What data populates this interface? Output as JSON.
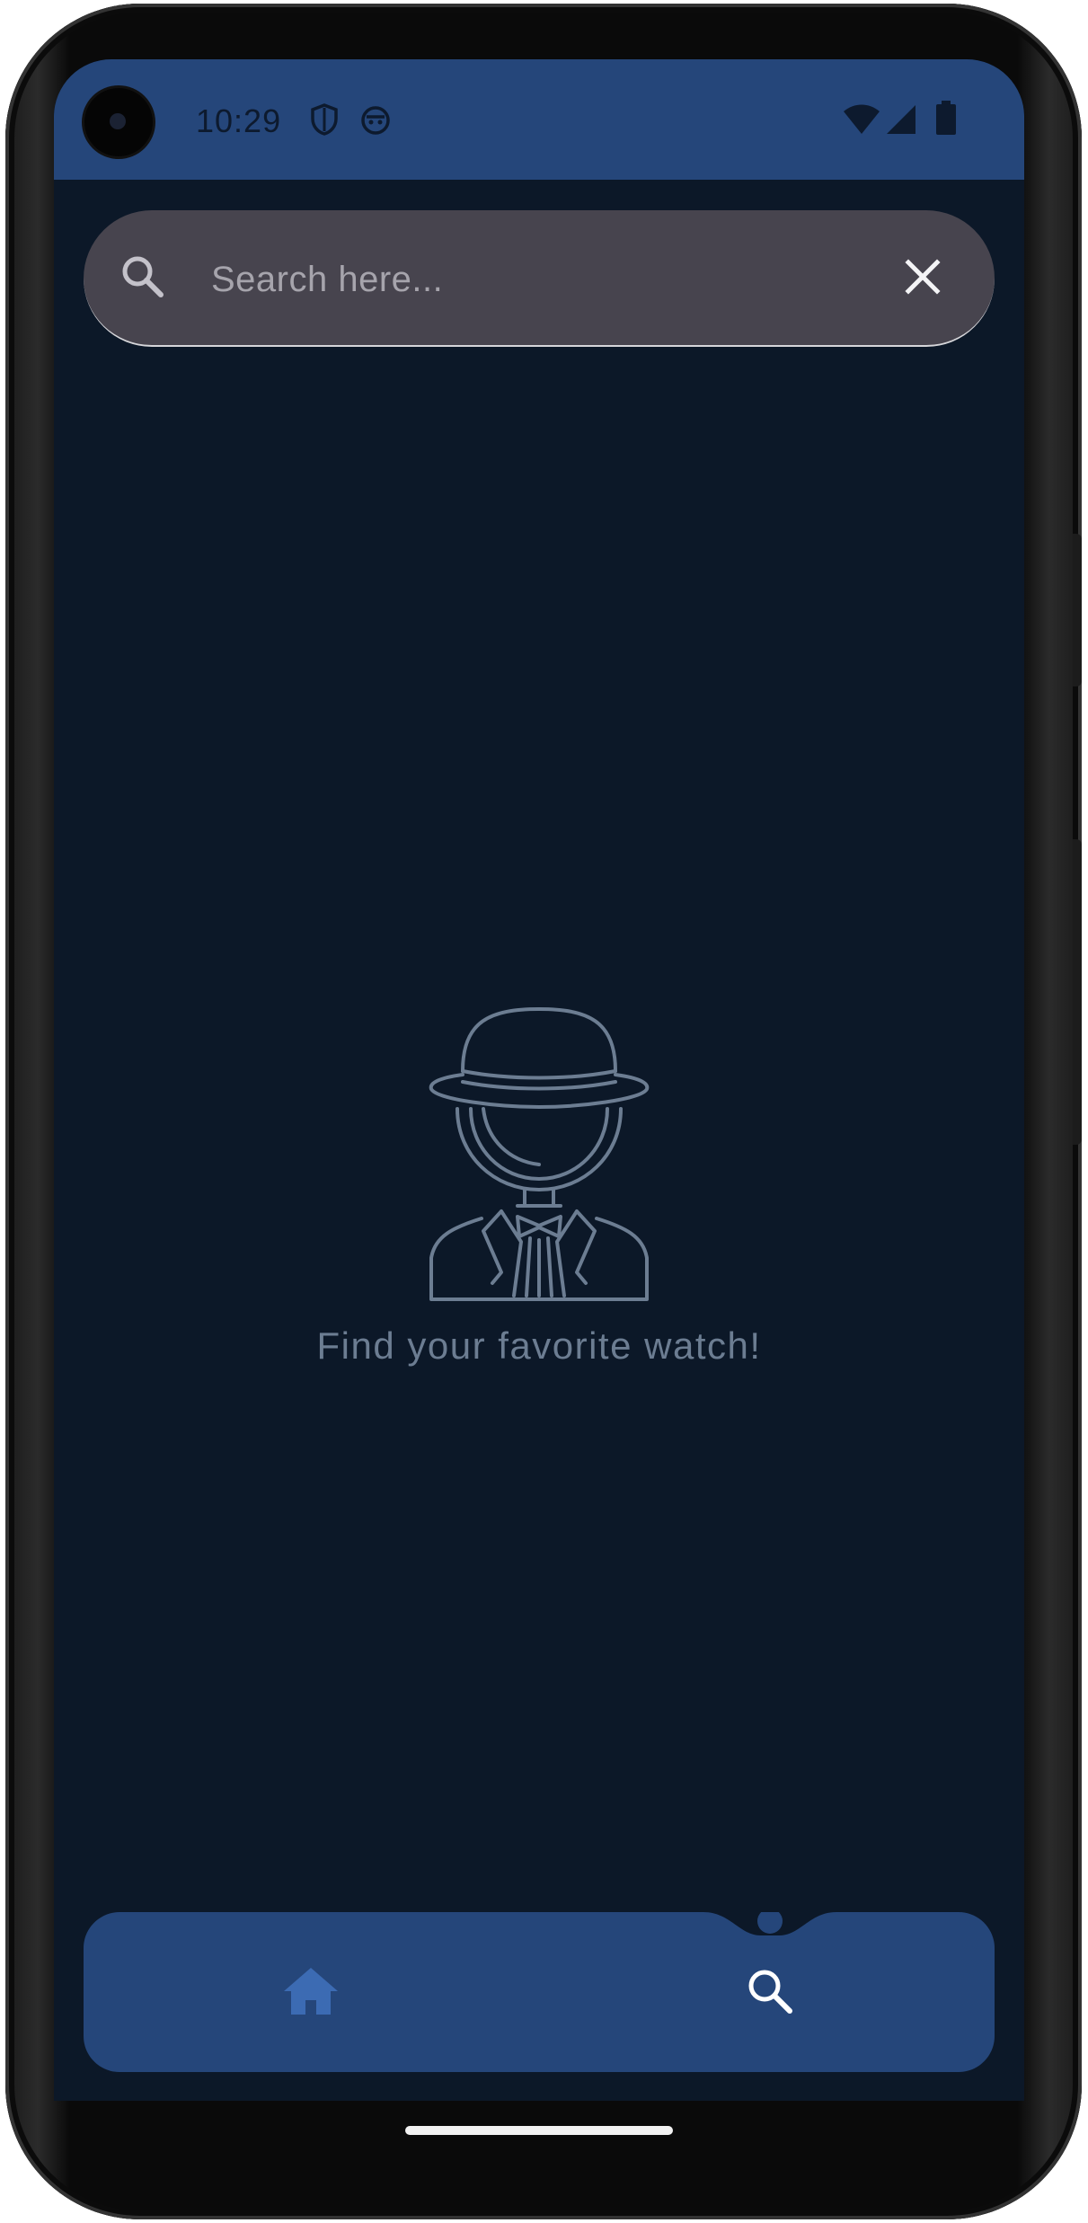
{
  "status_bar": {
    "time": "10:29",
    "left_icons": [
      "shield-icon",
      "status-app-icon"
    ],
    "right_icons": [
      "wifi-icon",
      "cellular-signal-icon",
      "battery-icon"
    ]
  },
  "search": {
    "placeholder": "Search here...",
    "value": "",
    "leading_icon": "search-icon",
    "trailing_icon": "close-icon"
  },
  "empty_state": {
    "illustration": "detective-icon",
    "message": "Find your favorite watch!"
  },
  "bottom_nav": {
    "items": [
      {
        "icon": "home-icon",
        "active": false
      },
      {
        "icon": "search-icon",
        "active": true
      }
    ]
  },
  "colors": {
    "background": "#0c1828",
    "status_bar": "#25467a",
    "nav_bar": "#25467a",
    "search_bar": "#47444e",
    "illustration_stroke": "#6c7d92",
    "active_icon": "#ffffff",
    "inactive_icon": "#3c6bb3"
  }
}
